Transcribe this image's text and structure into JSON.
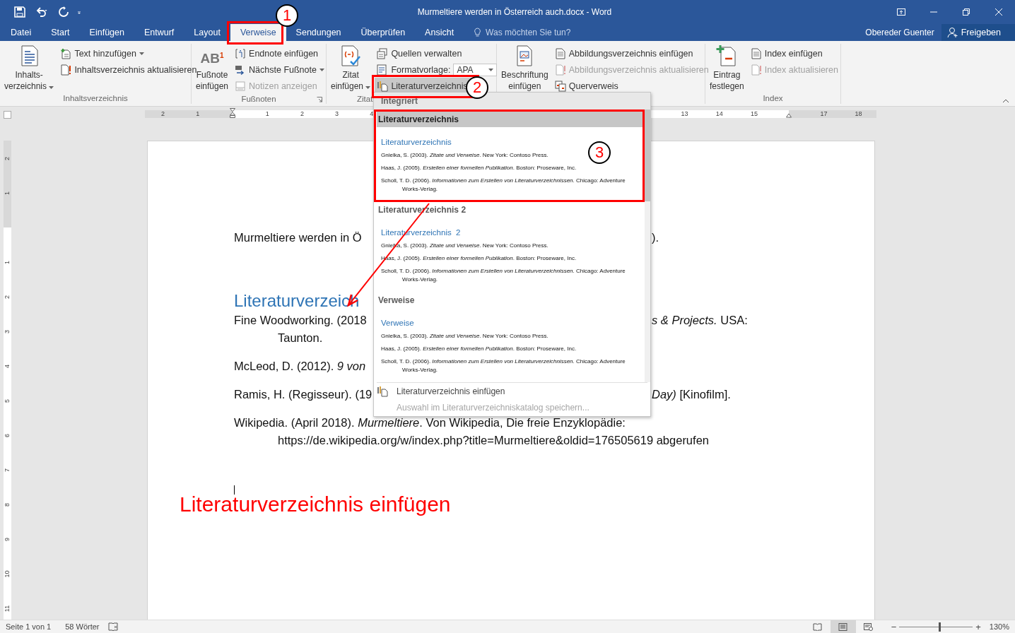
{
  "title_bar": {
    "title": "Murmeltiere werden in Österreich auch.docx - Word"
  },
  "tabs": [
    {
      "label": "Datei",
      "selected": false
    },
    {
      "label": "Start",
      "selected": false
    },
    {
      "label": "Einfügen",
      "selected": false
    },
    {
      "label": "Entwurf",
      "selected": false
    },
    {
      "label": "Layout",
      "selected": false
    },
    {
      "label": "Verweise",
      "selected": true
    },
    {
      "label": "Sendungen",
      "selected": false
    },
    {
      "label": "Überprüfen",
      "selected": false
    },
    {
      "label": "Ansicht",
      "selected": false
    }
  ],
  "tell_me": {
    "placeholder": "Was möchten Sie tun?"
  },
  "account": {
    "user": "Obereder Guenter",
    "share": "Freigeben"
  },
  "ribbon_groups": [
    {
      "label": "Inhaltsverzeichnis",
      "large": {
        "lines": [
          "Inhalts-",
          "verzeichnis"
        ],
        "menu": true
      },
      "small": [
        {
          "kind": "button",
          "label": "Text hinzufügen",
          "menu": true,
          "disabled": false,
          "pressed": false
        },
        {
          "kind": "button",
          "label": "Inhaltsverzeichnis aktualisieren",
          "menu": false,
          "disabled": false,
          "pressed": false
        }
      ]
    },
    {
      "label": "Fußnoten",
      "launcher": true,
      "large": {
        "lines": [
          "Fußnote",
          "einfügen"
        ],
        "menu": false,
        "glyph": "AB",
        "glyph_mark": "1"
      },
      "small": [
        {
          "kind": "button",
          "label": "Endnote einfügen",
          "menu": false,
          "disabled": false,
          "pressed": false
        },
        {
          "kind": "button",
          "label": "Nächste Fußnote",
          "menu": true,
          "disabled": false,
          "pressed": false
        },
        {
          "kind": "button",
          "label": "Notizen anzeigen",
          "menu": false,
          "disabled": true,
          "pressed": false
        }
      ]
    },
    {
      "label": "Zitat",
      "large": {
        "lines": [
          "Zitat",
          "einfügen"
        ],
        "menu": true
      },
      "small": [
        {
          "kind": "button",
          "label": "Quellen verwalten",
          "menu": false,
          "disabled": false,
          "pressed": false
        },
        {
          "kind": "combo",
          "label": "Formatvorlage:",
          "value": "APA"
        },
        {
          "kind": "button",
          "label": "Literaturverzeichnis",
          "menu": true,
          "disabled": false,
          "pressed": true
        }
      ]
    },
    {
      "large": {
        "lines": [
          "Beschriftung",
          "einfügen"
        ],
        "menu": false
      },
      "small": [
        {
          "kind": "button",
          "label": "Abbildungsverzeichnis einfügen",
          "menu": false,
          "disabled": false,
          "pressed": false
        },
        {
          "kind": "button",
          "label": "Abbildungsverzeichnis aktualisieren",
          "menu": false,
          "disabled": true,
          "pressed": false
        },
        {
          "kind": "button",
          "label": "Querverweis",
          "menu": false,
          "disabled": false,
          "pressed": false
        }
      ]
    },
    {
      "label": "Index",
      "large": {
        "lines": [
          "Eintrag",
          "festlegen"
        ],
        "menu": false
      },
      "small": [
        {
          "kind": "button",
          "label": "Index einfügen",
          "menu": false,
          "disabled": false,
          "pressed": false
        },
        {
          "kind": "button",
          "label": "Index aktualisieren",
          "menu": false,
          "disabled": true,
          "pressed": false
        }
      ]
    }
  ],
  "horizontal_ruler": [
    "2",
    "1",
    "1",
    "2",
    "3",
    "4",
    "13",
    "14",
    "15",
    "17",
    "18"
  ],
  "vertical_ruler": [
    "2",
    "1",
    "1",
    "2",
    "3",
    "4",
    "5",
    "6",
    "7",
    "8",
    "9",
    "10",
    "11"
  ],
  "document": {
    "paragraphs": [
      {
        "kind": "split",
        "left": "Murmeltiere werden in Ö",
        "right": ")."
      },
      {
        "kind": "heading",
        "text": "Literaturverzeich"
      },
      {
        "kind": "split",
        "left": "Fine Woodworking. (2018",
        "right": "*s & Projects.* USA:",
        "continuation": "Taunton."
      },
      {
        "kind": "split",
        "left": "McLeod, D. (2012). *9 von*"
      },
      {
        "kind": "split",
        "left": "Ramis, H. (Regisseur). (19",
        "right": "*Day)* [Kinofilm]."
      },
      {
        "kind": "entry",
        "text": "Wikipedia. (April 2018). *Murmeltiere*. Von Wikipedia, Die freie Enzyklopädie:",
        "continuation": "https://de.wikipedia.org/w/index.php?title=Murmeltiere&oldid=176505619 abgerufen"
      }
    ],
    "annotation": "Literaturverzeichnis einfügen"
  },
  "bibliography_menu": {
    "section": "Integriert",
    "gallery": [
      {
        "title": "Literaturverzeichnis",
        "hovered": true,
        "preview": {
          "heading": "Literaturverzeichnis",
          "entries": [
            "Gnielka, S. (2003). *Zitate und Verweise*. New York: Contoso Press.",
            "Haas, J. (2005). *Erstellen einer formellen Publikation*. Boston: Proseware, Inc.",
            "Scholl, T. D. (2006). *Informationen zum Erstellen von Literaturverzeichnissen*. Chicago: Adventure Works-Verlag."
          ]
        }
      },
      {
        "title": "Literaturverzeichnis 2",
        "hovered": false,
        "preview": {
          "heading": "Literaturverzeichnis  2",
          "entries": [
            "Gnielka, S. (2003). *Zitate und Verweise*. New York: Contoso Press.",
            "Haas, J. (2005). *Erstellen einer formellen Publikation*. Boston: Proseware, Inc.",
            "Scholl, T. D. (2006). *Informationen zum Erstellen von Literaturverzeichnissen*. Chicago: Adventure Works-Verlag."
          ]
        }
      },
      {
        "title": "Verweise",
        "hovered": false,
        "preview": {
          "heading": "Verweise",
          "entries": [
            "Gnielka, S. (2003). *Zitate und Verweise*. New York: Contoso Press.",
            "Haas, J. (2005). *Erstellen einer formellen Publikation*. Boston: Proseware, Inc.",
            "Scholl, T. D. (2006). *Informationen zum Erstellen von Literaturverzeichnissen*. Chicago: Adventure Works-Verlag."
          ]
        }
      }
    ],
    "commands": [
      {
        "label": "Literaturverzeichnis einfügen",
        "disabled": false
      },
      {
        "label": "Auswahl im Literaturverzeichniskatalog speichern...",
        "disabled": true
      }
    ]
  },
  "callouts": [
    "1",
    "2",
    "3"
  ],
  "status_bar": {
    "page": "Seite 1 von 1",
    "words": "58 Wörter",
    "views": [
      {
        "selected": false
      },
      {
        "selected": true
      },
      {
        "selected": false
      }
    ],
    "zoom_out": "−",
    "zoom_in": "+",
    "zoom": {
      "level": 0.55,
      "reading": "130%"
    }
  }
}
